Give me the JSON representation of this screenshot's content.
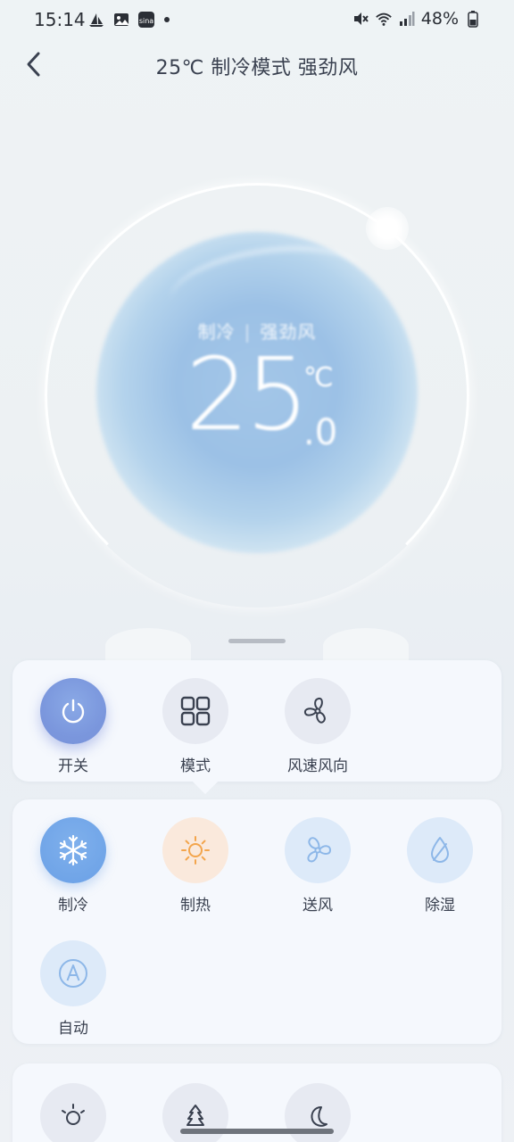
{
  "status_bar": {
    "time": "15:14",
    "battery": "48%",
    "left_icons": [
      "sailboat-icon",
      "image-icon",
      "sina-icon"
    ],
    "right_icons": [
      "mute-icon",
      "wifi-icon",
      "signal-icon",
      "battery-icon"
    ]
  },
  "header": {
    "title": "25℃ 制冷模式 强劲风"
  },
  "dial": {
    "mode": "制冷",
    "separator": "|",
    "fan": "强劲风",
    "temp_integer": "25",
    "temp_unit": "℃",
    "temp_decimal": ".0"
  },
  "controls": {
    "power": "开关",
    "mode": "模式",
    "fan": "风速风向"
  },
  "modes": {
    "cool": "制冷",
    "heat": "制热",
    "fan_only": "送风",
    "dry": "除湿",
    "auto": "自动"
  },
  "colors": {
    "power_accent": "#7b97dd",
    "cool_accent": "#6aa0e6",
    "heat_accent": "#f3a54c",
    "mode_icon_blue": "#8db7e8"
  }
}
